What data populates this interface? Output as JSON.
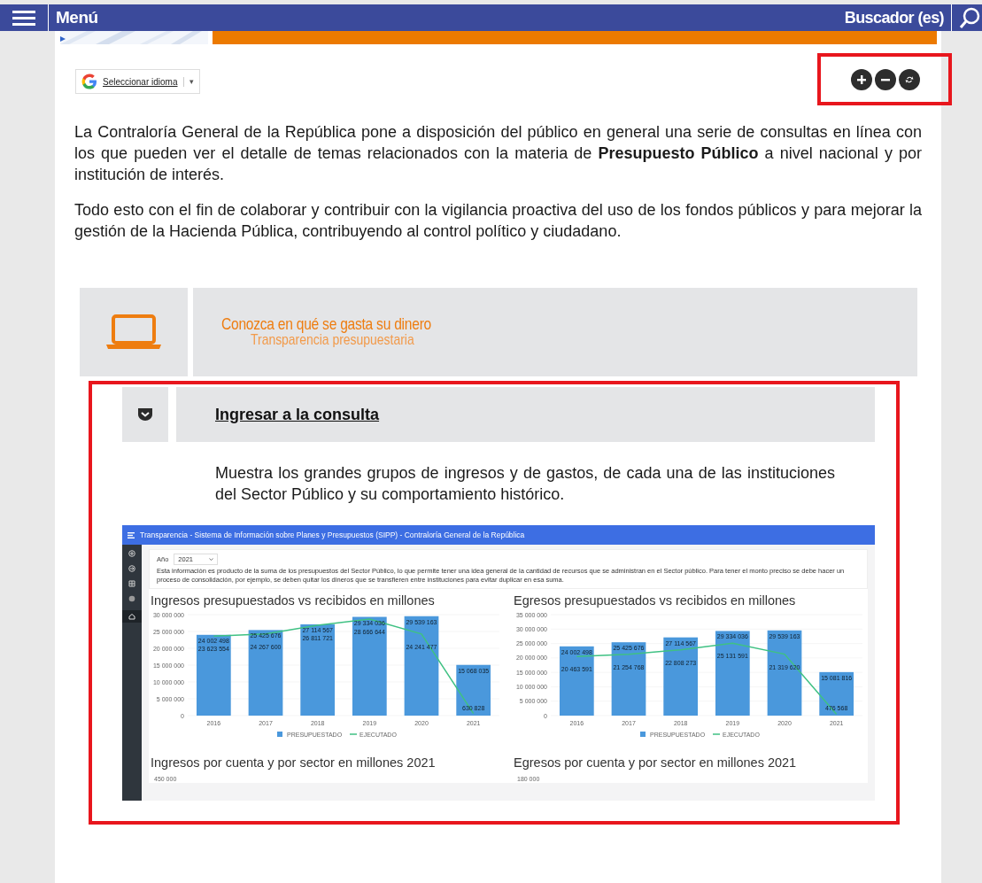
{
  "header": {
    "menu_label": "Menú",
    "search_label": "Buscador (es)"
  },
  "language_selector": {
    "label": "Seleccionar idioma",
    "caret": "▾"
  },
  "intro_paragraphs": [
    "La Contraloría General de la República pone a disposición del público en general una serie de consultas en línea con los que pueden ver el detalle de temas relacionados con la materia de **Presupuesto Público** a nivel nacional y por institución de interés.",
    "Todo esto con el fin de colaborar y contribuir con la vigilancia proactiva del uso de los fondos públicos y para mejorar la gestión de la Hacienda Pública, contribuyendo al control político y ciudadano."
  ],
  "section": {
    "title": "Conozca en qué se gasta su dinero",
    "subtitle": "Transparencia presupuestaria"
  },
  "consulta": {
    "link": "Ingresar a la consulta",
    "description": "Muestra los grandes grupos de ingresos y de gastos, de cada una de las instituciones del Sector Público y su comportamiento histórico."
  },
  "embedded_app": {
    "title": "Transparencia - Sistema de Información sobre Planes y Presupuestos (SIPP) - Contraloría General de la República",
    "year_label": "Año",
    "year_value": "2021",
    "note": "Esta información es producto de la suma de los presupuestos del Sector Público, lo que permite tener una idea general de la cantidad de recursos que se administran en el Sector público. Para tener el monto preciso se debe hacer un proceso de consolidación, por ejemplo, se deben quitar los dineros que se transfieren entre instituciones para evitar duplicar en esa suma.",
    "charts": [
      {
        "chart_data": {
          "type": "bar",
          "title": "Ingresos presupuestados vs recibidos en millones",
          "categories": [
            "2016",
            "2017",
            "2018",
            "2019",
            "2020",
            "2021"
          ],
          "series": [
            {
              "name": "PRESUPUESTADO",
              "type": "bar",
              "color": "#4a98dc",
              "values": [
                24002498,
                25425676,
                27114567,
                29334036,
                29539163,
                15068035
              ]
            },
            {
              "name": "EJECUTADO",
              "type": "line",
              "color": "#3fc183",
              "values": [
                23623554,
                24267600,
                26811721,
                28666644,
                24241477,
                630828
              ]
            }
          ],
          "ylim": [
            0,
            30000000
          ],
          "yticks": [
            {
              "value": 0,
              "label": "0"
            },
            {
              "value": 5000000,
              "label": "5 000 000"
            },
            {
              "value": 10000000,
              "label": "10 000 000"
            },
            {
              "value": 15000000,
              "label": "15 000 000"
            },
            {
              "value": 20000000,
              "label": "20 000 000"
            },
            {
              "value": 25000000,
              "label": "25 000 000"
            },
            {
              "value": 30000000,
              "label": "30 000 000"
            }
          ],
          "data_labels": true,
          "legend": "bottom",
          "grid": true
        }
      },
      {
        "chart_data": {
          "type": "bar",
          "title": "Egresos presupuestados vs recibidos en millones",
          "categories": [
            "2016",
            "2017",
            "2018",
            "2019",
            "2020",
            "2021"
          ],
          "series": [
            {
              "name": "PRESUPUESTADO",
              "type": "bar",
              "color": "#4a98dc",
              "values": [
                24002498,
                25425676,
                27114567,
                29334036,
                29539163,
                15081816
              ]
            },
            {
              "name": "EJECUTADO",
              "type": "line",
              "color": "#3fc183",
              "values": [
                20463591,
                21254768,
                22808273,
                25131591,
                21319620,
                476568
              ]
            }
          ],
          "ylim": [
            0,
            35000000
          ],
          "yticks": [
            {
              "value": 0,
              "label": "0"
            },
            {
              "value": 5000000,
              "label": "5 000 000"
            },
            {
              "value": 10000000,
              "label": "10 000 000"
            },
            {
              "value": 15000000,
              "label": "15 000 000"
            },
            {
              "value": 20000000,
              "label": "20 000 000"
            },
            {
              "value": 25000000,
              "label": "25 000 000"
            },
            {
              "value": 30000000,
              "label": "30 000 000"
            },
            {
              "value": 35000000,
              "label": "35 000 000"
            }
          ],
          "data_labels": true,
          "legend": "bottom",
          "grid": true
        }
      }
    ],
    "lower_charts": [
      {
        "title": "Ingresos por cuenta y por sector en millones 2021",
        "top_tick": "450 000"
      },
      {
        "title": "Egresos por cuenta y por sector en millones 2021",
        "top_tick": "180 000"
      }
    ]
  }
}
